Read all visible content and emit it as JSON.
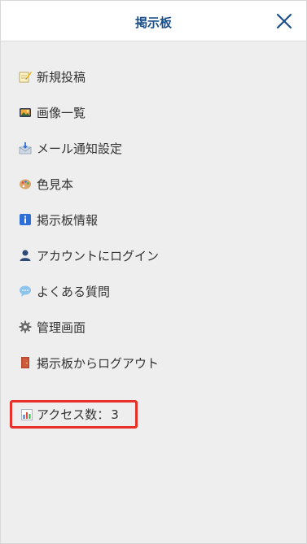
{
  "header": {
    "title": "掲示板",
    "close_icon": "close-icon"
  },
  "menu": {
    "items": [
      {
        "label": "新規投稿",
        "icon": "memo-pencil-icon"
      },
      {
        "label": "画像一覧",
        "icon": "photo-icon"
      },
      {
        "label": "メール通知設定",
        "icon": "mail-download-icon"
      },
      {
        "label": "色見本",
        "icon": "palette-icon"
      },
      {
        "label": "掲示板情報",
        "icon": "info-icon"
      },
      {
        "label": "アカウントにログイン",
        "icon": "user-icon"
      },
      {
        "label": "よくある質問",
        "icon": "speech-bubble-icon"
      },
      {
        "label": "管理画面",
        "icon": "gear-icon"
      },
      {
        "label": "掲示板からログアウト",
        "icon": "door-icon"
      }
    ]
  },
  "counter": {
    "label": "アクセス数：",
    "value": "3",
    "icon": "bar-chart-icon"
  },
  "colors": {
    "title": "#1b4f8a",
    "accent_border": "#e8302b",
    "background": "#eeeeee"
  }
}
